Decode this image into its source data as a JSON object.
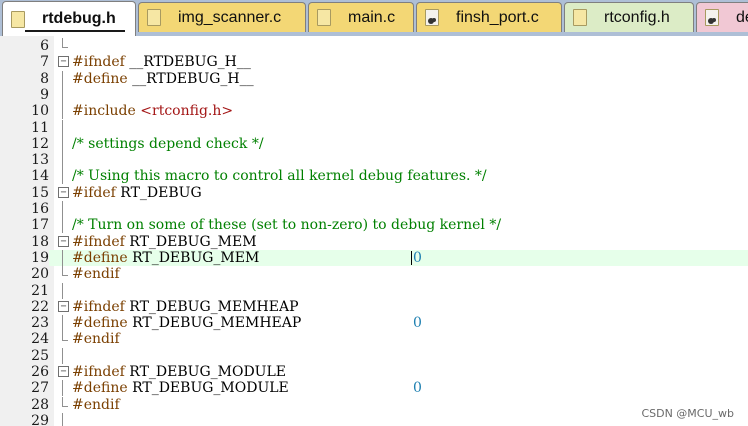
{
  "tabs": [
    {
      "label": "rtdebug.h",
      "kind": "h",
      "active": true
    },
    {
      "label": "img_scanner.c",
      "kind": "h",
      "active": false
    },
    {
      "label": "main.c",
      "kind": "h",
      "active": false
    },
    {
      "label": "finsh_port.c",
      "kind": "c",
      "active": false
    },
    {
      "label": "rtconfig.h",
      "kind": "h",
      "active": false
    },
    {
      "label": "de",
      "kind": "c",
      "active": false
    }
  ],
  "code_lines": [
    {
      "num": "6",
      "pp": "",
      "id": "",
      "cm": "",
      "value": ""
    },
    {
      "num": "7",
      "pp": "#ifndef",
      "id": " __RTDEBUG_H__",
      "cm": "",
      "value": ""
    },
    {
      "num": "8",
      "pp": "#define",
      "id": " __RTDEBUG_H__",
      "cm": "",
      "value": ""
    },
    {
      "num": "9",
      "pp": "",
      "id": "",
      "cm": "",
      "value": ""
    },
    {
      "num": "10",
      "pp": "#include",
      "id": " ",
      "inc": "<rtconfig.h>",
      "cm": "",
      "value": ""
    },
    {
      "num": "11",
      "pp": "",
      "id": "",
      "cm": "",
      "value": ""
    },
    {
      "num": "12",
      "pp": "",
      "id": "",
      "cm": "/* settings depend check */",
      "value": ""
    },
    {
      "num": "13",
      "pp": "",
      "id": "",
      "cm": "",
      "value": ""
    },
    {
      "num": "14",
      "pp": "",
      "id": "",
      "cm": "/* Using this macro to control all kernel debug features. */",
      "value": ""
    },
    {
      "num": "15",
      "pp": "#ifdef",
      "id": " RT_DEBUG",
      "cm": "",
      "value": ""
    },
    {
      "num": "16",
      "pp": "",
      "id": "",
      "cm": "",
      "value": ""
    },
    {
      "num": "17",
      "pp": "",
      "id": "",
      "cm": "/* Turn on some of these (set to non-zero) to debug kernel */",
      "value": ""
    },
    {
      "num": "18",
      "pp": "#ifndef",
      "id": " RT_DEBUG_MEM",
      "cm": "",
      "value": ""
    },
    {
      "num": "19",
      "pp": "#define",
      "id": " RT_DEBUG_MEM",
      "cm": "",
      "value": "0"
    },
    {
      "num": "20",
      "pp": "#endif",
      "id": "",
      "cm": "",
      "value": ""
    },
    {
      "num": "21",
      "pp": "",
      "id": "",
      "cm": "",
      "value": ""
    },
    {
      "num": "22",
      "pp": "#ifndef",
      "id": " RT_DEBUG_MEMHEAP",
      "cm": "",
      "value": ""
    },
    {
      "num": "23",
      "pp": "#define",
      "id": " RT_DEBUG_MEMHEAP",
      "cm": "",
      "value": "0"
    },
    {
      "num": "24",
      "pp": "#endif",
      "id": "",
      "cm": "",
      "value": ""
    },
    {
      "num": "25",
      "pp": "",
      "id": "",
      "cm": "",
      "value": ""
    },
    {
      "num": "26",
      "pp": "#ifndef",
      "id": " RT_DEBUG_MODULE",
      "cm": "",
      "value": ""
    },
    {
      "num": "27",
      "pp": "#define",
      "id": " RT_DEBUG_MODULE",
      "cm": "",
      "value": "0"
    },
    {
      "num": "28",
      "pp": "#endif",
      "id": "",
      "cm": "",
      "value": ""
    },
    {
      "num": "29",
      "pp": "",
      "id": "",
      "cm": "",
      "value": ""
    }
  ],
  "watermark": "CSDN @MCU_wb",
  "colors": {
    "preprocessor": "#7a3f00",
    "comment": "#008000",
    "number": "#1d7fb0",
    "current_line": "#e6ffea"
  }
}
